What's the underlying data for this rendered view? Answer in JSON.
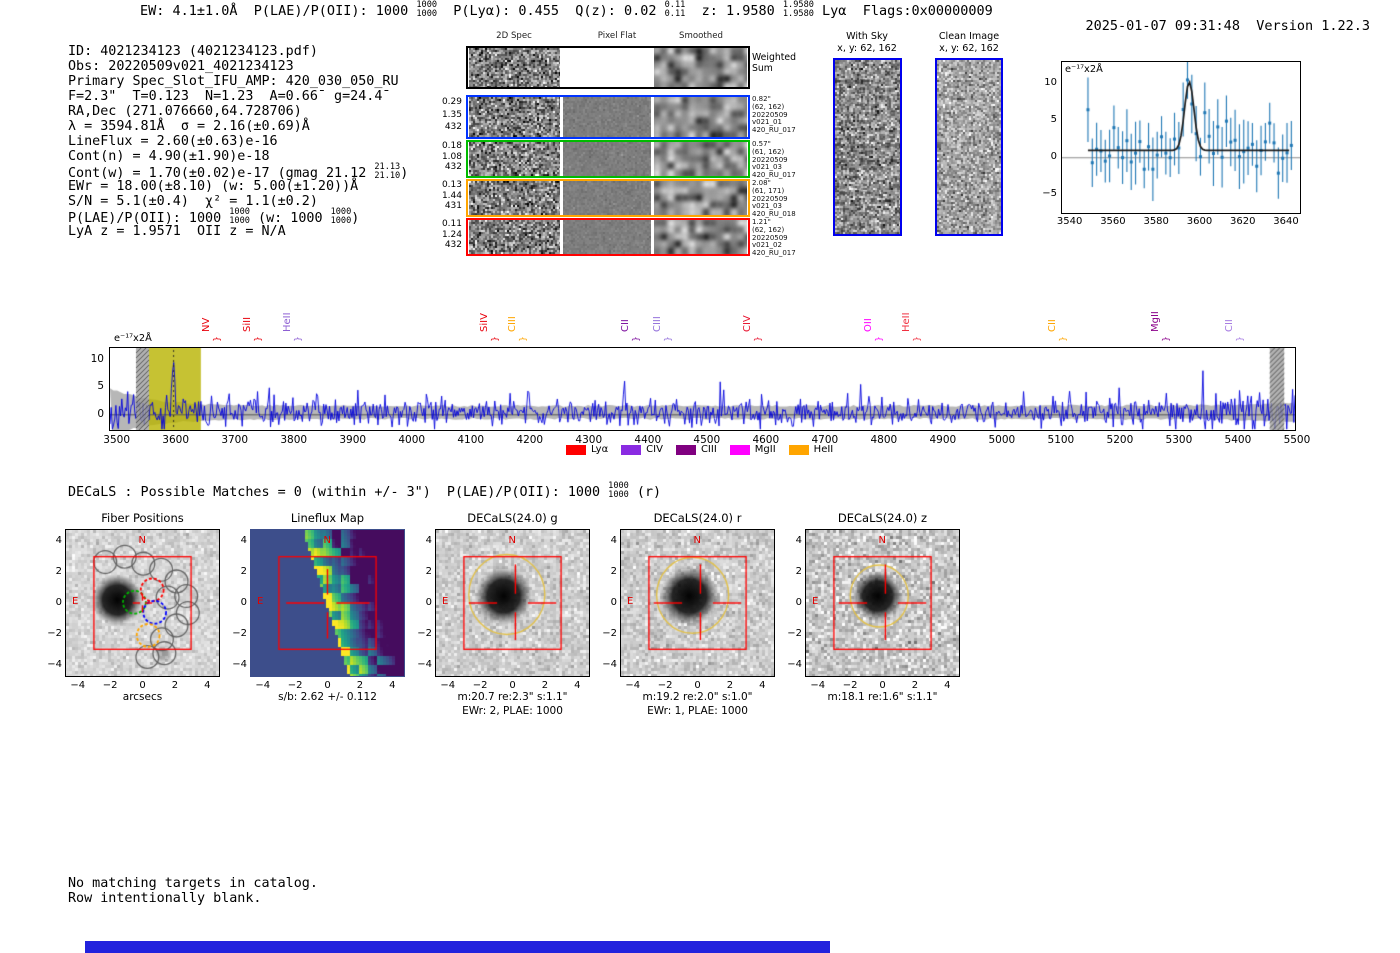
{
  "header": {
    "summary_segments": [
      {
        "t": "EW: 4.1±1.0Å  P(LAE)/P(OII): 1000 "
      },
      {
        "frac": [
          "1000",
          "1000"
        ]
      },
      {
        "t": "  P(Lyα): 0.455  Q(z): 0.02 "
      },
      {
        "frac": [
          "0.11",
          "0.11"
        ]
      },
      {
        "t": "  z: 1.9580 "
      },
      {
        "frac": [
          "1.9580",
          "1.9580"
        ]
      },
      {
        "t": " Lyα  Flags:0x00000009"
      }
    ],
    "datetime": "2025-01-07 09:31:48",
    "version": "Version 1.22.3"
  },
  "info_block": {
    "lines": [
      {
        "segs": [
          {
            "t": "ID: 4021234123 (4021234123.pdf)"
          }
        ]
      },
      {
        "segs": [
          {
            "t": "Obs: 20220509v021_4021234123"
          }
        ]
      },
      {
        "segs": [
          {
            "t": "Primary Spec_Slot_IFU_AMP: 420_030_050_RU"
          }
        ]
      },
      {
        "segs": [
          {
            "t": "F=2.3\"  T=0.12̄3  N=1.2̄3  A=0.66̄  g=24.4̄"
          }
        ]
      },
      {
        "segs": [
          {
            "t": "RA,Dec (271.076660,64.728706)"
          }
        ]
      },
      {
        "segs": [
          {
            "t": "λ = 3594.81Å  σ = 2.16(±0.69)Å"
          }
        ]
      },
      {
        "segs": [
          {
            "t": "LineFlux = 2.60(±0.63)e-16"
          }
        ]
      },
      {
        "segs": [
          {
            "t": "Cont(n) = 4.90(±1.90)e-18"
          }
        ]
      },
      {
        "segs": [
          {
            "t": "Cont(w) = 1.70(±0.02)e-17 (gmag 21.12 "
          },
          {
            "frac": [
              "21.13",
              "21.10"
            ]
          },
          {
            "t": ")"
          }
        ]
      },
      {
        "segs": [
          {
            "t": "EWr = 18.00(±8.10) (w: 5.00(±1.20))Å"
          }
        ]
      },
      {
        "segs": [
          {
            "t": "S/N = 5.1(±0.4)  χ² = 1.1(±0.2)"
          }
        ]
      },
      {
        "segs": [
          {
            "t": "P(LAE)/P(OII): 1000 "
          },
          {
            "frac": [
              "1000",
              "1000"
            ]
          },
          {
            "t": " (w: 1000 "
          },
          {
            "frac": [
              "1000",
              "1000"
            ]
          },
          {
            "t": ")"
          }
        ]
      },
      {
        "segs": [
          {
            "t": "LyA z = 1.9571  OII z = N/A"
          }
        ]
      }
    ]
  },
  "cutouts_2d": {
    "col_headers": [
      "2D Spec",
      "Pixel Flat",
      "Smoothed"
    ],
    "rows": [
      {
        "border": "#000000",
        "left": [],
        "right": [
          "Weighted",
          "Sum"
        ],
        "right_style": "big"
      },
      {
        "border": "#0033ff",
        "left": [
          "0.29",
          "1.35",
          "432"
        ],
        "right": [
          "0.82\"",
          "(62, 162)",
          "20220509",
          "v021_01",
          "420_RU_017"
        ]
      },
      {
        "border": "#00bb00",
        "left": [
          "0.18",
          "1.08",
          "432"
        ],
        "right": [
          "0.57\"",
          "(61, 162)",
          "20220509",
          "v021_03",
          "420_RU_017"
        ]
      },
      {
        "border": "#ffa500",
        "left": [
          "0.13",
          "1.44",
          "431"
        ],
        "right": [
          "2.08\"",
          "(61, 171)",
          "20220509",
          "v021_03",
          "420_RU_018"
        ]
      },
      {
        "border": "#ff0000",
        "left": [
          "0.11",
          "1.24",
          "432"
        ],
        "right": [
          "1.21\"",
          "(62, 162)",
          "20220509",
          "v021_02",
          "420_RU_017"
        ]
      }
    ]
  },
  "with_sky": {
    "title": "With Sky",
    "coords": "x, y: 62, 162"
  },
  "clean_image": {
    "title": "Clean Image",
    "coords": "x, y: 62, 162"
  },
  "chart_data": [
    {
      "id": "line_fit_plot",
      "type": "scatter",
      "title": "",
      "xlabel": "",
      "ylabel": "e⁻¹⁷x2Å",
      "xlim": [
        3536,
        3646
      ],
      "ylim": [
        -7.5,
        13
      ],
      "xticks": [
        3540,
        3560,
        3580,
        3600,
        3620,
        3640
      ],
      "yticks": [
        10,
        5,
        0,
        -5
      ],
      "fit_curve": {
        "model": "gaussian",
        "center": 3594.81,
        "sigma": 2.16,
        "amplitude": 9.3,
        "baseline": 1.0,
        "color": "#1a1a1a"
      },
      "points": {
        "synthetic": true,
        "x_start": 3548,
        "x_end": 3642,
        "step": 2,
        "baseline": 1.0,
        "noise_sd": 2.0,
        "yerr": 3.4,
        "seed": 7,
        "color": "#1f77b4"
      }
    },
    {
      "id": "full_spectrum",
      "type": "line",
      "title": "",
      "xlabel": "",
      "ylabel": "e⁻¹⁷x2Å",
      "xlim": [
        3487,
        5495
      ],
      "ylim": [
        -2.75,
        12.1
      ],
      "xticks": [
        3500,
        3600,
        3700,
        3800,
        3900,
        4000,
        4100,
        4200,
        4300,
        4400,
        4500,
        4600,
        4700,
        4800,
        4900,
        5000,
        5100,
        5200,
        5300,
        5400,
        5500
      ],
      "yticks": [
        10,
        5,
        0
      ],
      "series_color": "#0000dd",
      "emission_line": {
        "center": 3594.81,
        "sigma": 2.4,
        "height": 10.2
      },
      "noise": {
        "seed": 11,
        "sd": 1.15,
        "spike_prob": 0.05,
        "spike_mag": 3.4,
        "baseline": 0.3
      },
      "error_band": {
        "center": 0.45,
        "halfwidth": 1.0,
        "edge_boost": 3.2,
        "color": "#b7b7b7"
      },
      "highlight_band": {
        "x0": 3553,
        "x1": 3641,
        "color": "rgba(184,179,0,0.8)"
      },
      "hatch_bands": [
        [
          3531,
          3553
        ],
        [
          5452,
          5477
        ]
      ],
      "marker_line": {
        "x": 3594.81,
        "style": "dotted"
      },
      "line_labels": [
        {
          "label": "NV",
          "wave": 3669,
          "color": "#e8000b"
        },
        {
          "label": "SiII",
          "wave": 3737,
          "color": "#e8000b"
        },
        {
          "label": "HeII",
          "wave": 3805,
          "color": "#8d5fd3"
        },
        {
          "label": "SiIV",
          "wave": 4139,
          "color": "#e8000b"
        },
        {
          "label": "CIII",
          "wave": 4186,
          "color": "#ffa500"
        },
        {
          "label": "CII",
          "wave": 4378,
          "color": "#7d0f9e"
        },
        {
          "label": "CIII",
          "wave": 4432,
          "color": "#9370db"
        },
        {
          "label": "CIV",
          "wave": 4585,
          "color": "#e8112d"
        },
        {
          "label": "OII",
          "wave": 4790,
          "color": "#ff00ff"
        },
        {
          "label": "HeII",
          "wave": 4854,
          "color": "#f03040"
        },
        {
          "label": "CII",
          "wave": 5102,
          "color": "#ffa500"
        },
        {
          "label": "MgII",
          "wave": 5276,
          "color": "#8b008b"
        },
        {
          "label": "CII",
          "wave": 5402,
          "color": "#a57ae2"
        }
      ],
      "legend": [
        {
          "label": "Lyα",
          "color": "#ff0000"
        },
        {
          "label": "CIV",
          "color": "#8a2be2"
        },
        {
          "label": "CIII",
          "color": "#800080"
        },
        {
          "label": "MgII",
          "color": "#ff00ff"
        },
        {
          "label": "HeII",
          "color": "#ffa500"
        }
      ]
    }
  ],
  "decals": {
    "header_segments": [
      {
        "t": "DECaLS : Possible Matches = 0 (within +/- 3\")  P(LAE)/P(OII): 1000 "
      },
      {
        "frac": [
          "1000",
          "1000"
        ]
      },
      {
        "t": " (r)"
      }
    ]
  },
  "panels": [
    {
      "id": "fiber",
      "title": "Fiber Positions",
      "xlabel": "arcsecs",
      "captions": [],
      "ticks": [
        -4,
        -2,
        0,
        2,
        4
      ],
      "compass": {
        "north": "N",
        "east": "E"
      }
    },
    {
      "id": "lineflux",
      "title": "Lineflux Map",
      "captions": [
        "s/b: 2.62 +/- 0.112"
      ],
      "ticks": [
        -4,
        -2,
        0,
        2,
        4
      ],
      "compass": {
        "north": "N",
        "east": "E"
      }
    },
    {
      "id": "g",
      "title": "DECaLS(24.0) g",
      "captions": [
        "m:20.7 re:2.3\" s:1.1\"",
        "EWr: 2, PLAE: 1000"
      ],
      "ticks": [
        -4,
        -2,
        0,
        2,
        4
      ],
      "compass": {
        "north": "N",
        "east": "E"
      }
    },
    {
      "id": "r",
      "title": "DECaLS(24.0) r",
      "captions": [
        "m:19.2 re:2.0\" s:1.0\"",
        "EWr: 1, PLAE: 1000"
      ],
      "ticks": [
        -4,
        -2,
        0,
        2,
        4
      ],
      "compass": {
        "north": "N",
        "east": "E"
      }
    },
    {
      "id": "z",
      "title": "DECaLS(24.0) z",
      "captions": [
        "m:18.1 re:1.6\" s:1.1\""
      ],
      "ticks": [
        -4,
        -2,
        0,
        2,
        4
      ],
      "compass": {
        "north": "N",
        "east": "E"
      }
    }
  ],
  "footer": {
    "line1": "No matching targets in catalog.",
    "line2": "Row intentionally blank."
  },
  "colors": {
    "blue_panel_border": "#0000ee",
    "bottom_bar": "#2222dd",
    "compass": "#e00000",
    "crosshair": "#ff0000",
    "aperture_ellipse": "#e2c14b",
    "highlight_band": "#b8b300"
  }
}
